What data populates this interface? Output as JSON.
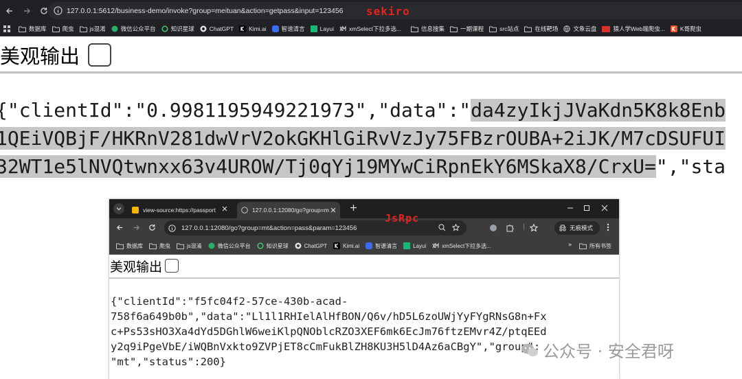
{
  "main_browser": {
    "url": "127.0.0.1:5612/business-demo/invoke?group=meituan&action=getpass&input=123456",
    "overlay_label": "sekiro",
    "bookmarks": [
      "数据库",
      "爬虫",
      "js混淆",
      "微信公众平台",
      "知识星球",
      "ChatGPT",
      "Kimi.ai",
      "智谱清言",
      "Layui",
      "xmSelect下拉多选...",
      "信息搜集",
      "一期课程",
      "src站点",
      "在线靶场",
      "文象云盘",
      "猿人学Web端爬虫...",
      "K哥爬虫"
    ]
  },
  "page": {
    "pretty_label": "美观输出",
    "json_lines": [
      {
        "plain": "{\"clientId\":\"0.9981195949221973\",\"data\":\"",
        "selected": "da4zyIkjJVaKdn5K8k8Enb"
      },
      {
        "plain": "",
        "selected": "1QEiVQBjF/HKRnV281dwVrV2okGKHlGiRvVzJy75FBzrOUBA+2iJK/M7cDSUFUI"
      },
      {
        "selected": "32WT1e5lNVQtwnxx63v4UROW/Tj0qYj19MYwCiRpnEkY6MSkaX8/CrxU=",
        "plain": "\",\"sta"
      }
    ]
  },
  "inner_window": {
    "overlay_label": "JsRpc",
    "tabs": [
      {
        "label": "view-source:https://passport"
      },
      {
        "label": "127.0.0.1:12080/go?group=m"
      }
    ],
    "url": "127.0.0.1:12080/go?group=mt&action=pass&param=123456",
    "incognito_label": "无痕模式",
    "bookmarks": [
      "数据库",
      "爬虫",
      "js混淆",
      "微信公众平台",
      "知识星球",
      "ChatGPT",
      "Kimi.ai",
      "智谱清言",
      "Layui",
      "xmSelect下拉多选..."
    ],
    "all_bookmarks_label": "所有书签",
    "pretty_label": "美观输出",
    "json_lines": [
      "{\"clientId\":\"f5fc04f2-57ce-430b-acad-",
      "758f6a649b0b\",\"data\":\"Ll1l1RHIelAlHfBON/Q6v/hD5L6zoUWjYyFYgRNsG8n+Fx",
      "c+Ps53sHO3Xa4dYd5DGhlW6weiKlpQNOblcRZO3XEF6mk6EcJm76ftzEMvr4Z/ptqEEd",
      "y2q9iPgeVbE/iWQBnVxkto9ZVPjET8cCmFukBlZH8KU3H5lD4Az6aCBgY\",\"group\":",
      "\"mt\",\"status\":200}"
    ]
  },
  "watermark": "公众号 · 安全君呀"
}
